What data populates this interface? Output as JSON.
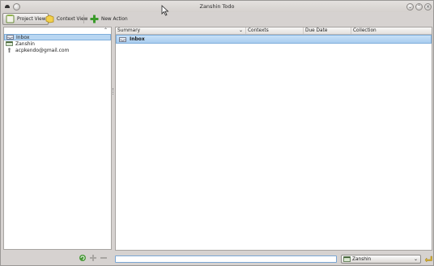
{
  "window": {
    "title": "Zanshin Todo"
  },
  "toolbar": {
    "project_view_label": "Project View",
    "context_view_label": "Context View",
    "new_action_label": "New Action"
  },
  "sidebar": {
    "sort_icon": "chevron-up-icon",
    "items": [
      {
        "label": "Inbox",
        "icon": "inbox-icon",
        "selected": true
      },
      {
        "label": "Zanshin",
        "icon": "folder-icon",
        "selected": false
      },
      {
        "label": "acpkendo@gmail.com",
        "icon": "person-icon",
        "selected": false
      }
    ]
  },
  "table": {
    "columns": [
      "Summary",
      "Contexts",
      "Due Date",
      "Collection"
    ],
    "rows": [
      {
        "summary": "Inbox",
        "icon": "inbox-icon"
      }
    ]
  },
  "bottom": {
    "collection_selected": "Zanshin",
    "quick_entry_value": ""
  },
  "colors": {
    "selection": "#b8d6f2",
    "window_bg": "#d6d2d0",
    "accent_green": "#3a9a2a"
  }
}
